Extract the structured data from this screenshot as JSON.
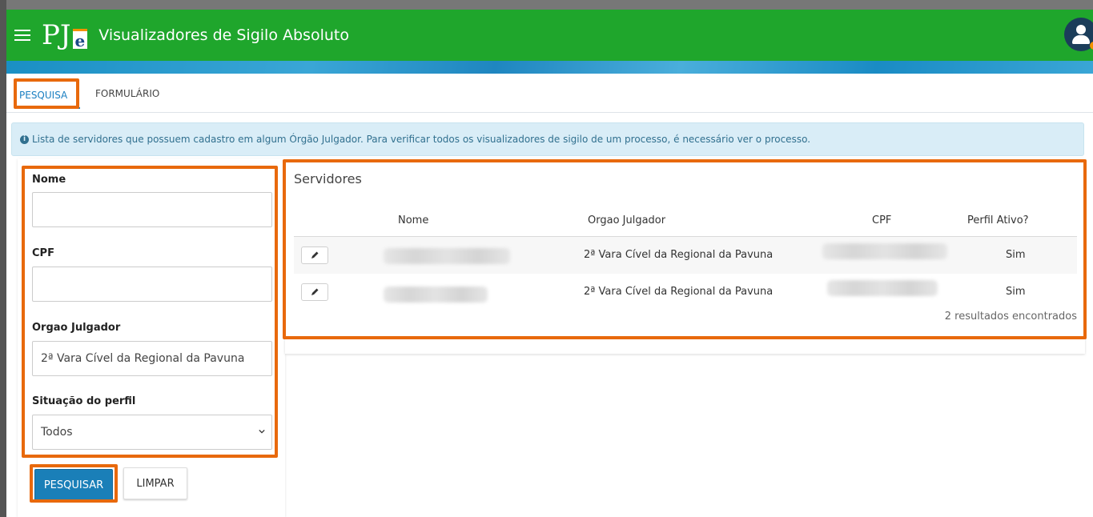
{
  "header": {
    "logo_main": "PJ",
    "logo_accent": "e",
    "title": "Visualizadores de Sigilo Absoluto",
    "indicator": "ı"
  },
  "tabs": [
    {
      "label": "PESQUISA",
      "active": true
    },
    {
      "label": "FORMULÁRIO",
      "active": false
    }
  ],
  "alert": {
    "icon": "info-icon",
    "text": "Lista de servidores que possuem cadastro em algum Órgão Julgador. Para verificar todos os visualizadores de sigilo de um processo, é necessário ver o processo."
  },
  "form": {
    "nome": {
      "label": "Nome",
      "value": ""
    },
    "cpf": {
      "label": "CPF",
      "value": ""
    },
    "orgao": {
      "label": "Orgao Julgador",
      "value": "2ª Vara Cível da Regional da Pavuna"
    },
    "situacao": {
      "label": "Situação do perfil",
      "value": "Todos"
    },
    "pesquisar_label": "PESQUISAR",
    "limpar_label": "LIMPAR"
  },
  "results": {
    "title": "Servidores",
    "columns": [
      "Nome",
      "Orgao Julgador",
      "CPF",
      "Perfil Ativo?"
    ],
    "rows": [
      {
        "orgao": "2ª Vara Cível da Regional da Pavuna",
        "ativo": "Sim"
      },
      {
        "orgao": "2ª Vara Cível da Regional da Pavuna",
        "ativo": "Sim"
      }
    ],
    "count_text": "2 resultados encontrados"
  },
  "colors": {
    "header_green": "#1fa62c",
    "primary_blue": "#1a7fb8",
    "highlight_orange": "#e8690c",
    "alert_bg": "#d9edf7"
  }
}
